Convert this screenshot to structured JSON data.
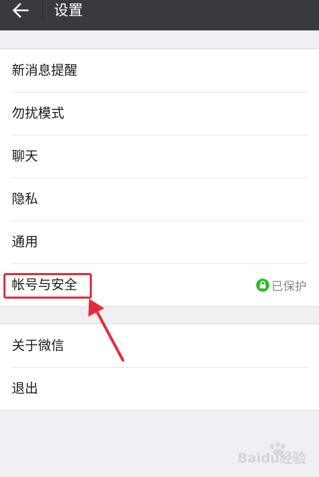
{
  "header": {
    "back_icon": "arrow-left-icon",
    "title": "设置"
  },
  "group1": [
    {
      "label": "新消息提醒"
    },
    {
      "label": "勿扰模式"
    },
    {
      "label": "聊天"
    },
    {
      "label": "隐私"
    },
    {
      "label": "通用"
    },
    {
      "label": "帐号与安全",
      "status": "已保护",
      "status_icon": "lock-icon"
    }
  ],
  "group2": [
    {
      "label": "关于微信"
    },
    {
      "label": "退出"
    }
  ],
  "annotation": {
    "highlight_color": "#e52b3a",
    "arrow_icon": "red-arrow-icon"
  },
  "watermark": {
    "text": "Baidu经验"
  },
  "colors": {
    "topbar": "#393a3f",
    "background": "#efeff4",
    "protected_badge": "#2dbb28"
  }
}
